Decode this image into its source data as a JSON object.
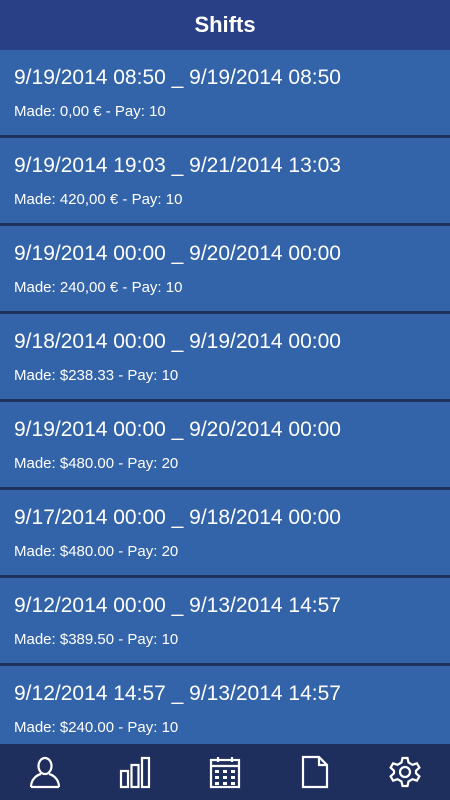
{
  "header": {
    "title": "Shifts"
  },
  "shifts": [
    {
      "range": "9/19/2014 08:50 _ 9/19/2014 08:50",
      "meta": "Made: 0,00 € - Pay: 10"
    },
    {
      "range": "9/19/2014 19:03 _ 9/21/2014 13:03",
      "meta": "Made: 420,00 € - Pay: 10"
    },
    {
      "range": "9/19/2014 00:00 _ 9/20/2014 00:00",
      "meta": "Made: 240,00 € - Pay: 10"
    },
    {
      "range": "9/18/2014 00:00 _ 9/19/2014 00:00",
      "meta": "Made: $238.33 - Pay: 10"
    },
    {
      "range": "9/19/2014 00:00 _ 9/20/2014 00:00",
      "meta": "Made: $480.00 - Pay: 20"
    },
    {
      "range": "9/17/2014 00:00 _ 9/18/2014 00:00",
      "meta": "Made: $480.00 - Pay: 20"
    },
    {
      "range": "9/12/2014 00:00 _ 9/13/2014 14:57",
      "meta": "Made: $389.50 - Pay: 10"
    },
    {
      "range": "9/12/2014 14:57 _ 9/13/2014 14:57",
      "meta": "Made: $240.00 - Pay: 10"
    }
  ],
  "nav": {
    "icons": [
      "user-icon",
      "bar-chart-icon",
      "calendar-icon",
      "document-icon",
      "settings-icon"
    ]
  },
  "colors": {
    "header_bg": "#2a4086",
    "row_bg": "#3363a8",
    "nav_bg": "#1f2f5d",
    "text": "#ffffff"
  }
}
